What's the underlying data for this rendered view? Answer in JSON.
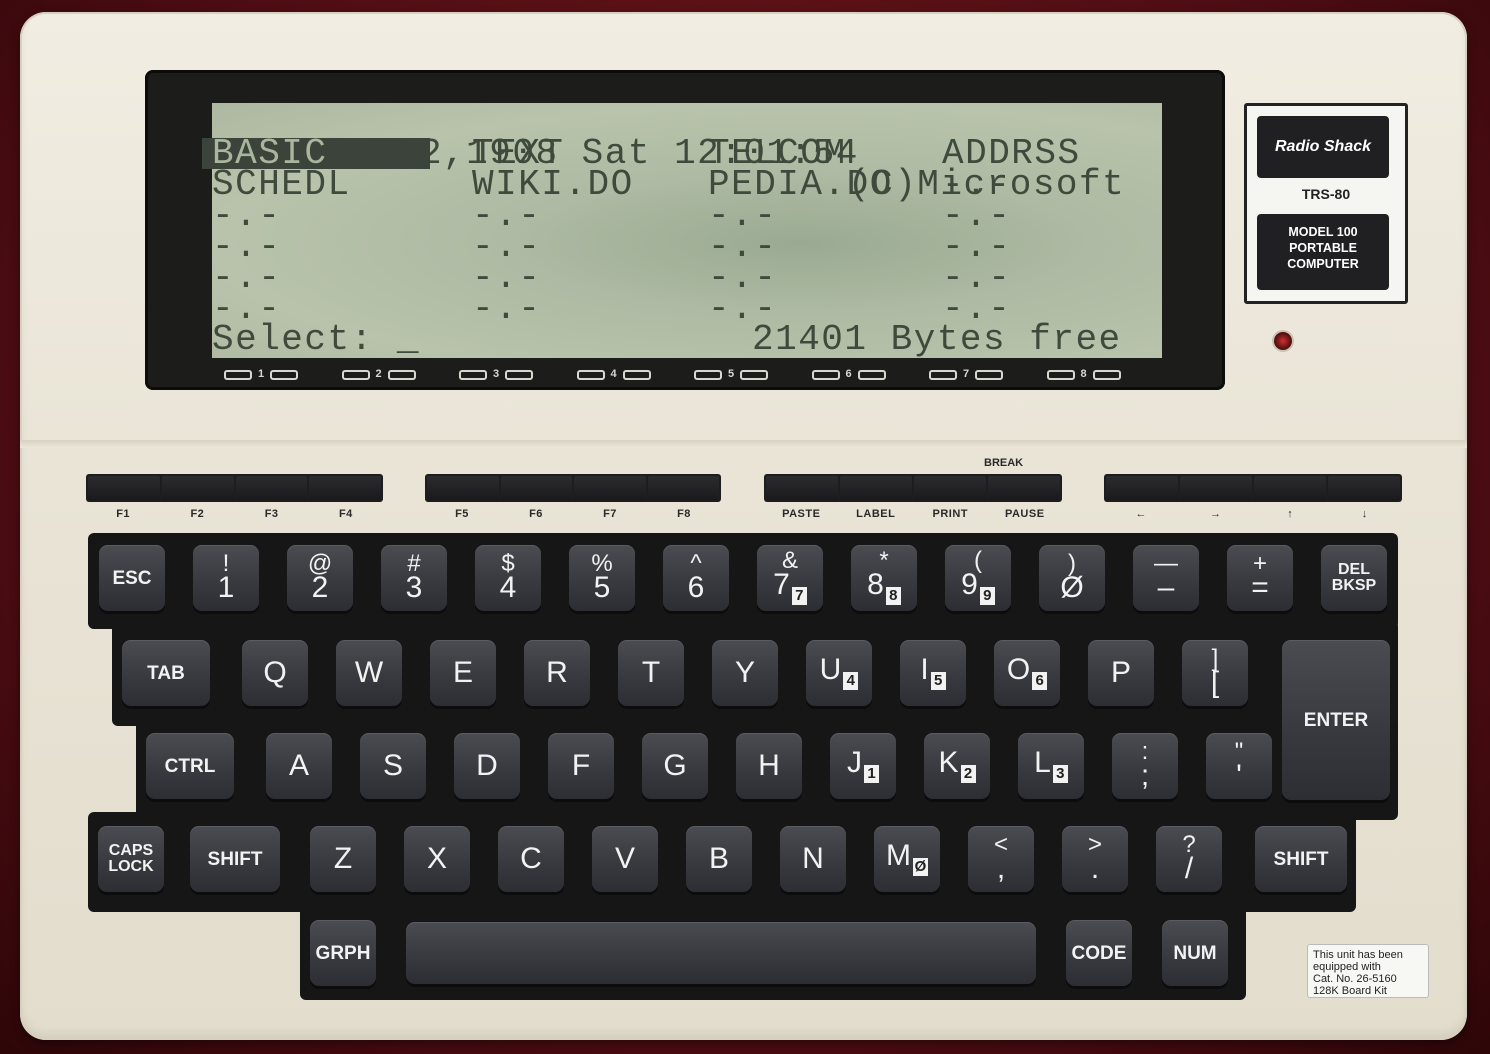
{
  "screen": {
    "status_date": "Jan 12,1908 Sat 12:01:54",
    "status_copyright": "(C)Microsoft",
    "menu": [
      [
        "BASIC",
        "TEXT",
        "TELCOM",
        "ADDRSS"
      ],
      [
        "SCHEDL",
        "WIKI.DO",
        "PEDIA.DO",
        "-.-"
      ],
      [
        "-.-",
        "-.-",
        "-.-",
        "-.-"
      ],
      [
        "-.-",
        "-.-",
        "-.-",
        "-.-"
      ],
      [
        "-.-",
        "-.-",
        "-.-",
        "-.-"
      ],
      [
        "-.-",
        "-.-",
        "-.-",
        "-.-"
      ]
    ],
    "selected_item": "BASIC",
    "prompt": "Select: _",
    "free_bytes": "21401 Bytes free",
    "softkey_numbers": [
      "1",
      "2",
      "3",
      "4",
      "5",
      "6",
      "7",
      "8"
    ]
  },
  "badge": {
    "brand": "Radio Shack",
    "model_line": "TRS-80",
    "desc_line1": "MODEL 100",
    "desc_line2": "PORTABLE",
    "desc_line3": "COMPUTER"
  },
  "function_keys": {
    "break_label": "BREAK",
    "labels": [
      "F1",
      "F2",
      "F3",
      "F4",
      "F5",
      "F6",
      "F7",
      "F8",
      "PASTE",
      "LABEL",
      "PRINT",
      "PAUSE",
      "←",
      "→",
      "↑",
      "↓"
    ]
  },
  "keys": {
    "row1": [
      {
        "main": "ESC"
      },
      {
        "top": "!",
        "main": "1"
      },
      {
        "top": "@",
        "main": "2"
      },
      {
        "top": "#",
        "main": "3"
      },
      {
        "top": "$",
        "main": "4"
      },
      {
        "top": "%",
        "main": "5"
      },
      {
        "top": "^",
        "main": "6"
      },
      {
        "top": "&",
        "main": "7",
        "num": "7"
      },
      {
        "top": "*",
        "main": "8",
        "num": "8"
      },
      {
        "top": "(",
        "main": "9",
        "num": "9"
      },
      {
        "top": ")",
        "main": "Ø"
      },
      {
        "top": "—",
        "main": "–"
      },
      {
        "top": "+",
        "main": "="
      },
      {
        "top": "DEL",
        "main": "BKSP"
      }
    ],
    "row2": [
      {
        "main": "TAB"
      },
      {
        "main": "Q"
      },
      {
        "main": "W"
      },
      {
        "main": "E"
      },
      {
        "main": "R"
      },
      {
        "main": "T"
      },
      {
        "main": "Y"
      },
      {
        "main": "U",
        "num": "4"
      },
      {
        "main": "I",
        "num": "5"
      },
      {
        "main": "O",
        "num": "6"
      },
      {
        "main": "P"
      },
      {
        "top": "]",
        "main": "["
      }
    ],
    "enter": "ENTER",
    "row3": [
      {
        "main": "CTRL"
      },
      {
        "main": "A"
      },
      {
        "main": "S"
      },
      {
        "main": "D"
      },
      {
        "main": "F"
      },
      {
        "main": "G"
      },
      {
        "main": "H"
      },
      {
        "main": "J",
        "num": "1"
      },
      {
        "main": "K",
        "num": "2"
      },
      {
        "main": "L",
        "num": "3"
      },
      {
        "top": ":",
        "main": ";"
      },
      {
        "top": "\"",
        "main": "'"
      }
    ],
    "row4": [
      {
        "top": "CAPS",
        "main": "LOCK"
      },
      {
        "main": "SHIFT"
      },
      {
        "main": "Z"
      },
      {
        "main": "X"
      },
      {
        "main": "C"
      },
      {
        "main": "V"
      },
      {
        "main": "B"
      },
      {
        "main": "N"
      },
      {
        "main": "M",
        "num": "Ø"
      },
      {
        "top": "<",
        "main": ","
      },
      {
        "top": ">",
        "main": "."
      },
      {
        "top": "?",
        "main": "/"
      },
      {
        "main": "SHIFT"
      }
    ],
    "row5": [
      {
        "main": "GRPH"
      },
      {
        "main": ""
      },
      {
        "main": "CODE"
      },
      {
        "main": "NUM"
      }
    ]
  },
  "sticker": {
    "line1": "This unit has been",
    "line2": "equipped with",
    "line3": "Cat. No. 26-5160",
    "line4": "128K Board Kit"
  }
}
